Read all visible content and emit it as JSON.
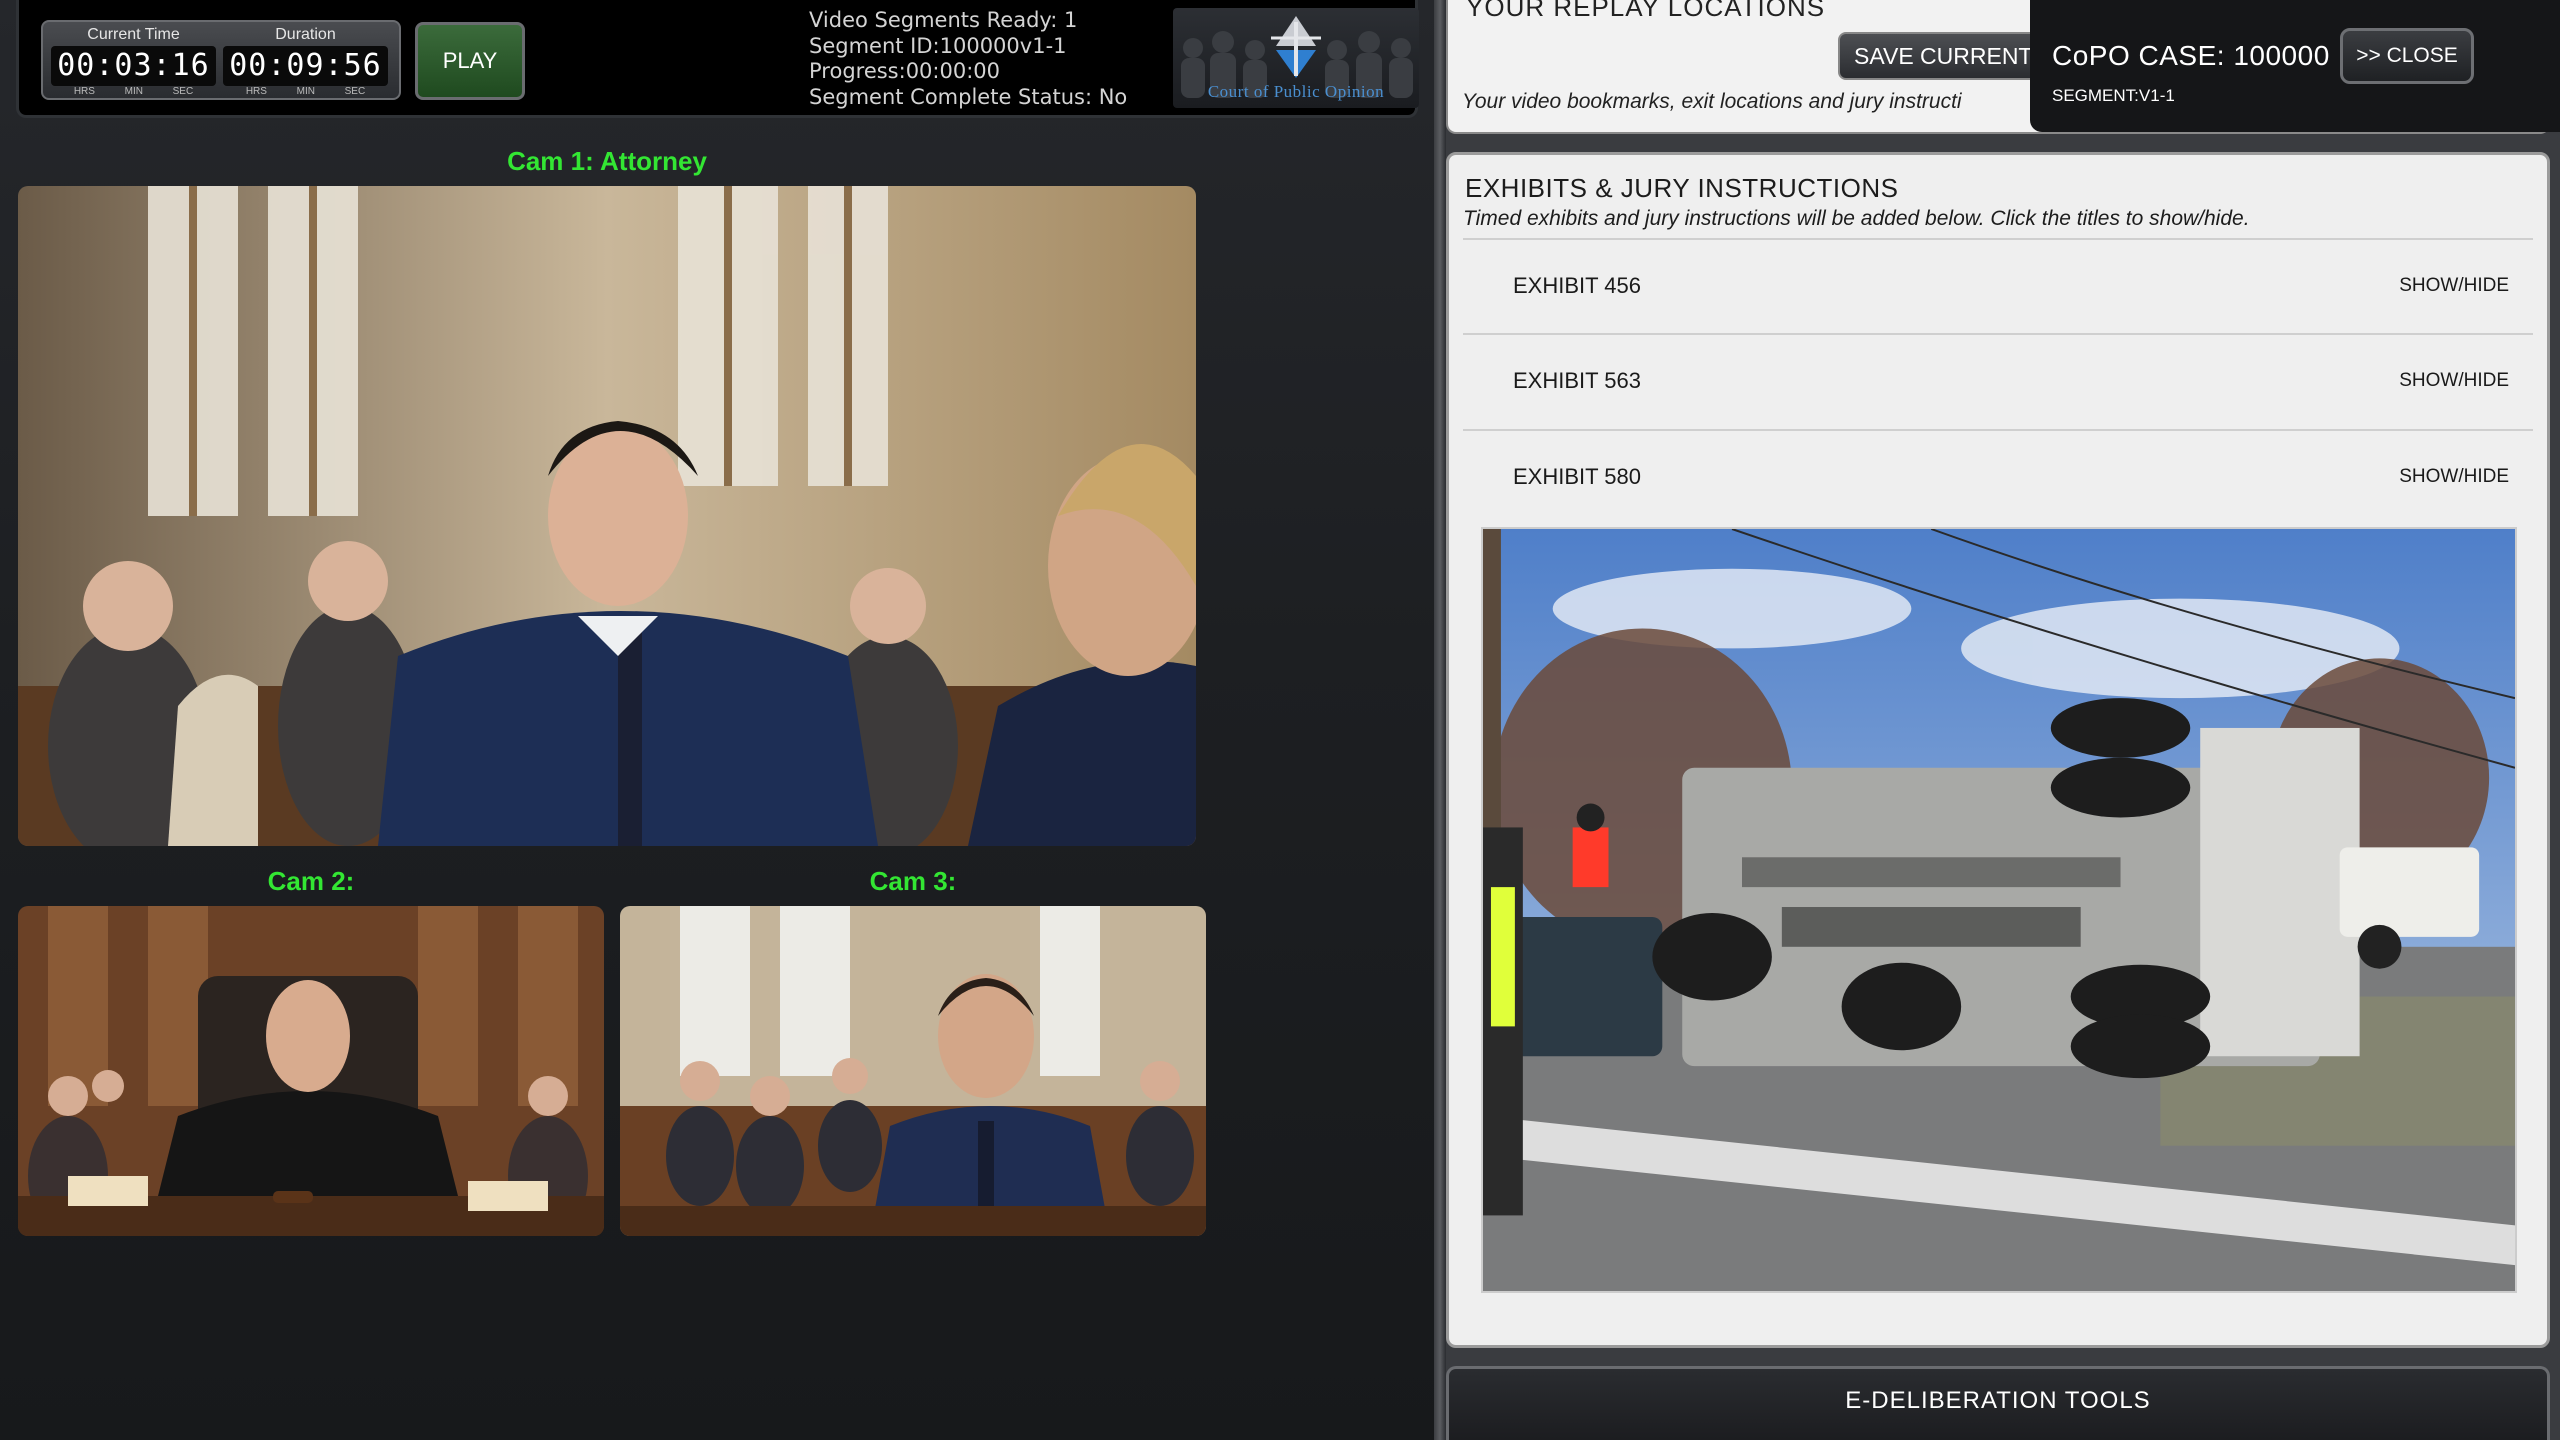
{
  "player": {
    "current_time_label": "Current Time",
    "current_time": "00:03:16",
    "duration_label": "Duration",
    "duration": "00:09:56",
    "units": [
      "HRS",
      "MIN",
      "SEC"
    ],
    "play_label": "PLAY"
  },
  "segment_status": {
    "line1": "Video Segments Ready: 1",
    "line2": "Segment ID:100000v1-1",
    "line3": "Progress:00:00:00",
    "line4": "Segment Complete Status: No"
  },
  "logo": {
    "text": "Court of Public Opinion"
  },
  "cameras": [
    {
      "label": "Cam 1: Attorney"
    },
    {
      "label": "Cam 2:"
    },
    {
      "label": "Cam 3:"
    }
  ],
  "replay": {
    "title": "YOUR REPLAY LOCATIONS",
    "save_label": "SAVE CURRENT",
    "description": "Your video bookmarks, exit locations and jury instructi"
  },
  "case": {
    "title": "CoPO CASE: 100000",
    "segment": "SEGMENT:V1-1",
    "close_label": ">> CLOSE"
  },
  "exhibits": {
    "title": "EXHIBITS & JURY INSTRUCTIONS",
    "description": "Timed exhibits and jury instructions will be added below. Click the titles to show/hide.",
    "items": [
      {
        "name": "EXHIBIT 456",
        "toggle": "SHOW/HIDE"
      },
      {
        "name": "EXHIBIT 563",
        "toggle": "SHOW/HIDE"
      },
      {
        "name": "EXHIBIT 580",
        "toggle": "SHOW/HIDE"
      }
    ]
  },
  "edeliberation": {
    "title": "E-DELIBERATION TOOLS"
  },
  "colors": {
    "cam_label": "#33e633",
    "play_button": "#2d5a2d",
    "panel_bg": "#efefef",
    "logo_accent": "#4a8fd0"
  }
}
